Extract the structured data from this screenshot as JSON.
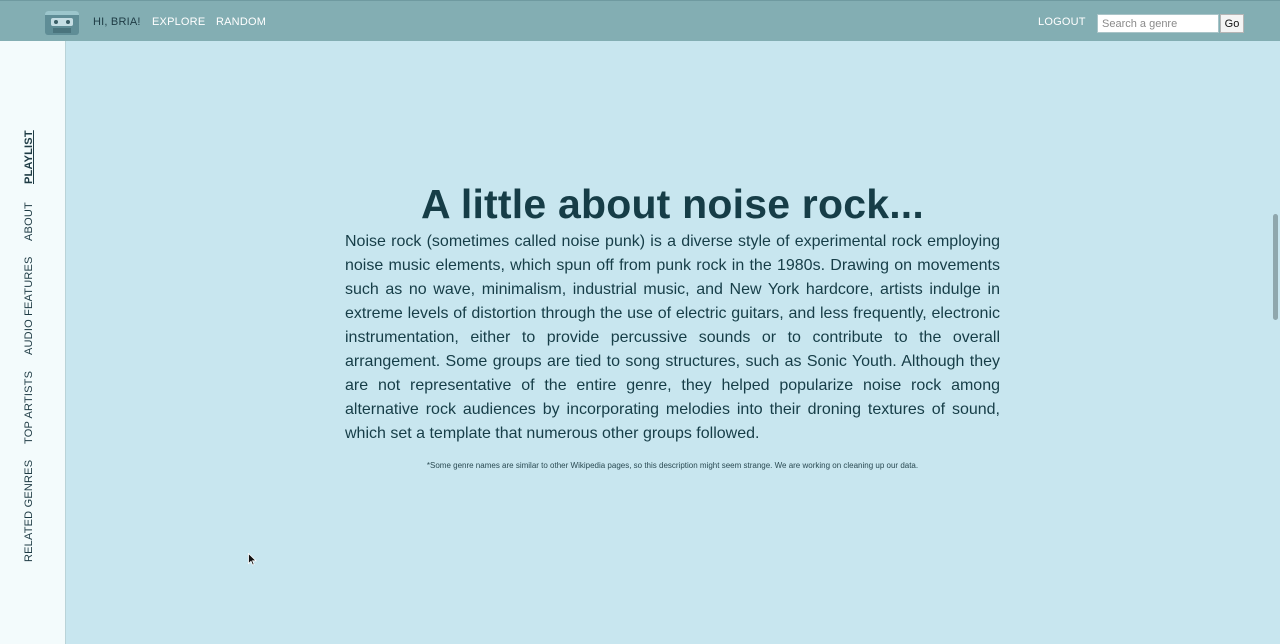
{
  "header": {
    "greeting": "HI, BRIA!",
    "nav": {
      "explore": "EXPLORE",
      "random": "RANDOM",
      "logout": "LOGOUT"
    },
    "search": {
      "placeholder": "Search a genre",
      "button": "Go"
    }
  },
  "sidebar": {
    "items": [
      "PLAYLIST",
      "ABOUT",
      "AUDIO FEATURES",
      "TOP ARTISTS",
      "RELATED GENRES"
    ],
    "active": "PLAYLIST"
  },
  "main": {
    "title": "A little about noise rock...",
    "description": "Noise rock (sometimes called noise punk) is a diverse style of experimental rock employing noise music elements, which spun off from punk rock in the 1980s. Drawing on movements such as no wave, minimalism, industrial music, and New York hardcore, artists indulge in extreme levels of distortion through the use of electric guitars, and less frequently, electronic instrumentation, either to provide percussive sounds or to contribute to the overall arrangement. Some groups are tied to song structures, such as Sonic Youth. Although they are not representative of the entire genre, they helped popularize noise rock among alternative rock audiences by incorporating melodies into their droning textures of sound, which set a template that numerous other groups followed.",
    "footnote": "*Some genre names are similar to other Wikipedia pages, so this description might seem strange. We are working on cleaning up our data."
  },
  "icons": {
    "logo": "cassette-logo-icon",
    "cursor": "mouse-pointer-icon"
  },
  "colors": {
    "header": "#83aeb3",
    "sidebar": "#f3fbfc",
    "main": "#c8e6ef",
    "heading": "#163d47"
  }
}
